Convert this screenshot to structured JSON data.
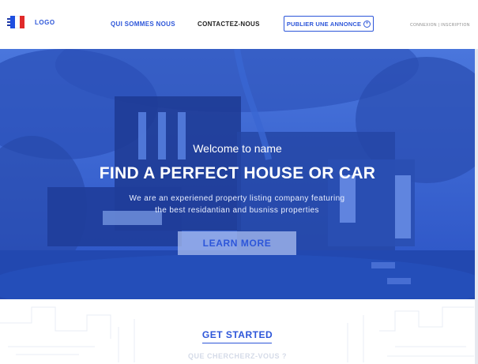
{
  "header": {
    "logo": "LOGO",
    "nav": [
      "QUI SOMMES NOUS",
      "CONTACTEZ-NOUS"
    ],
    "publish_label": "PUBLIER UNE ANNONCE",
    "publish_icon": "plus-circle-icon",
    "auth_label": "CONNEXION | INSCRIPTION",
    "flag_icon": "french-flag-icon"
  },
  "hero": {
    "welcome": "Welcome to name",
    "title": "FIND A PERFECT HOUSE OR CAR",
    "desc_line1": "We are an experiened property listing company featuring",
    "desc_line2": "the best residantian and busniss properties",
    "cta_label": "LEARN MORE"
  },
  "section": {
    "heading": "GET STARTED",
    "subheading": "QUE CHERCHERZ-VOUS ?"
  },
  "colors": {
    "brand_blue": "#2d56d9",
    "hero_overlay": "#2f5fd0",
    "flag_blue": "#1f4fe0",
    "flag_red": "#e02a2a"
  }
}
